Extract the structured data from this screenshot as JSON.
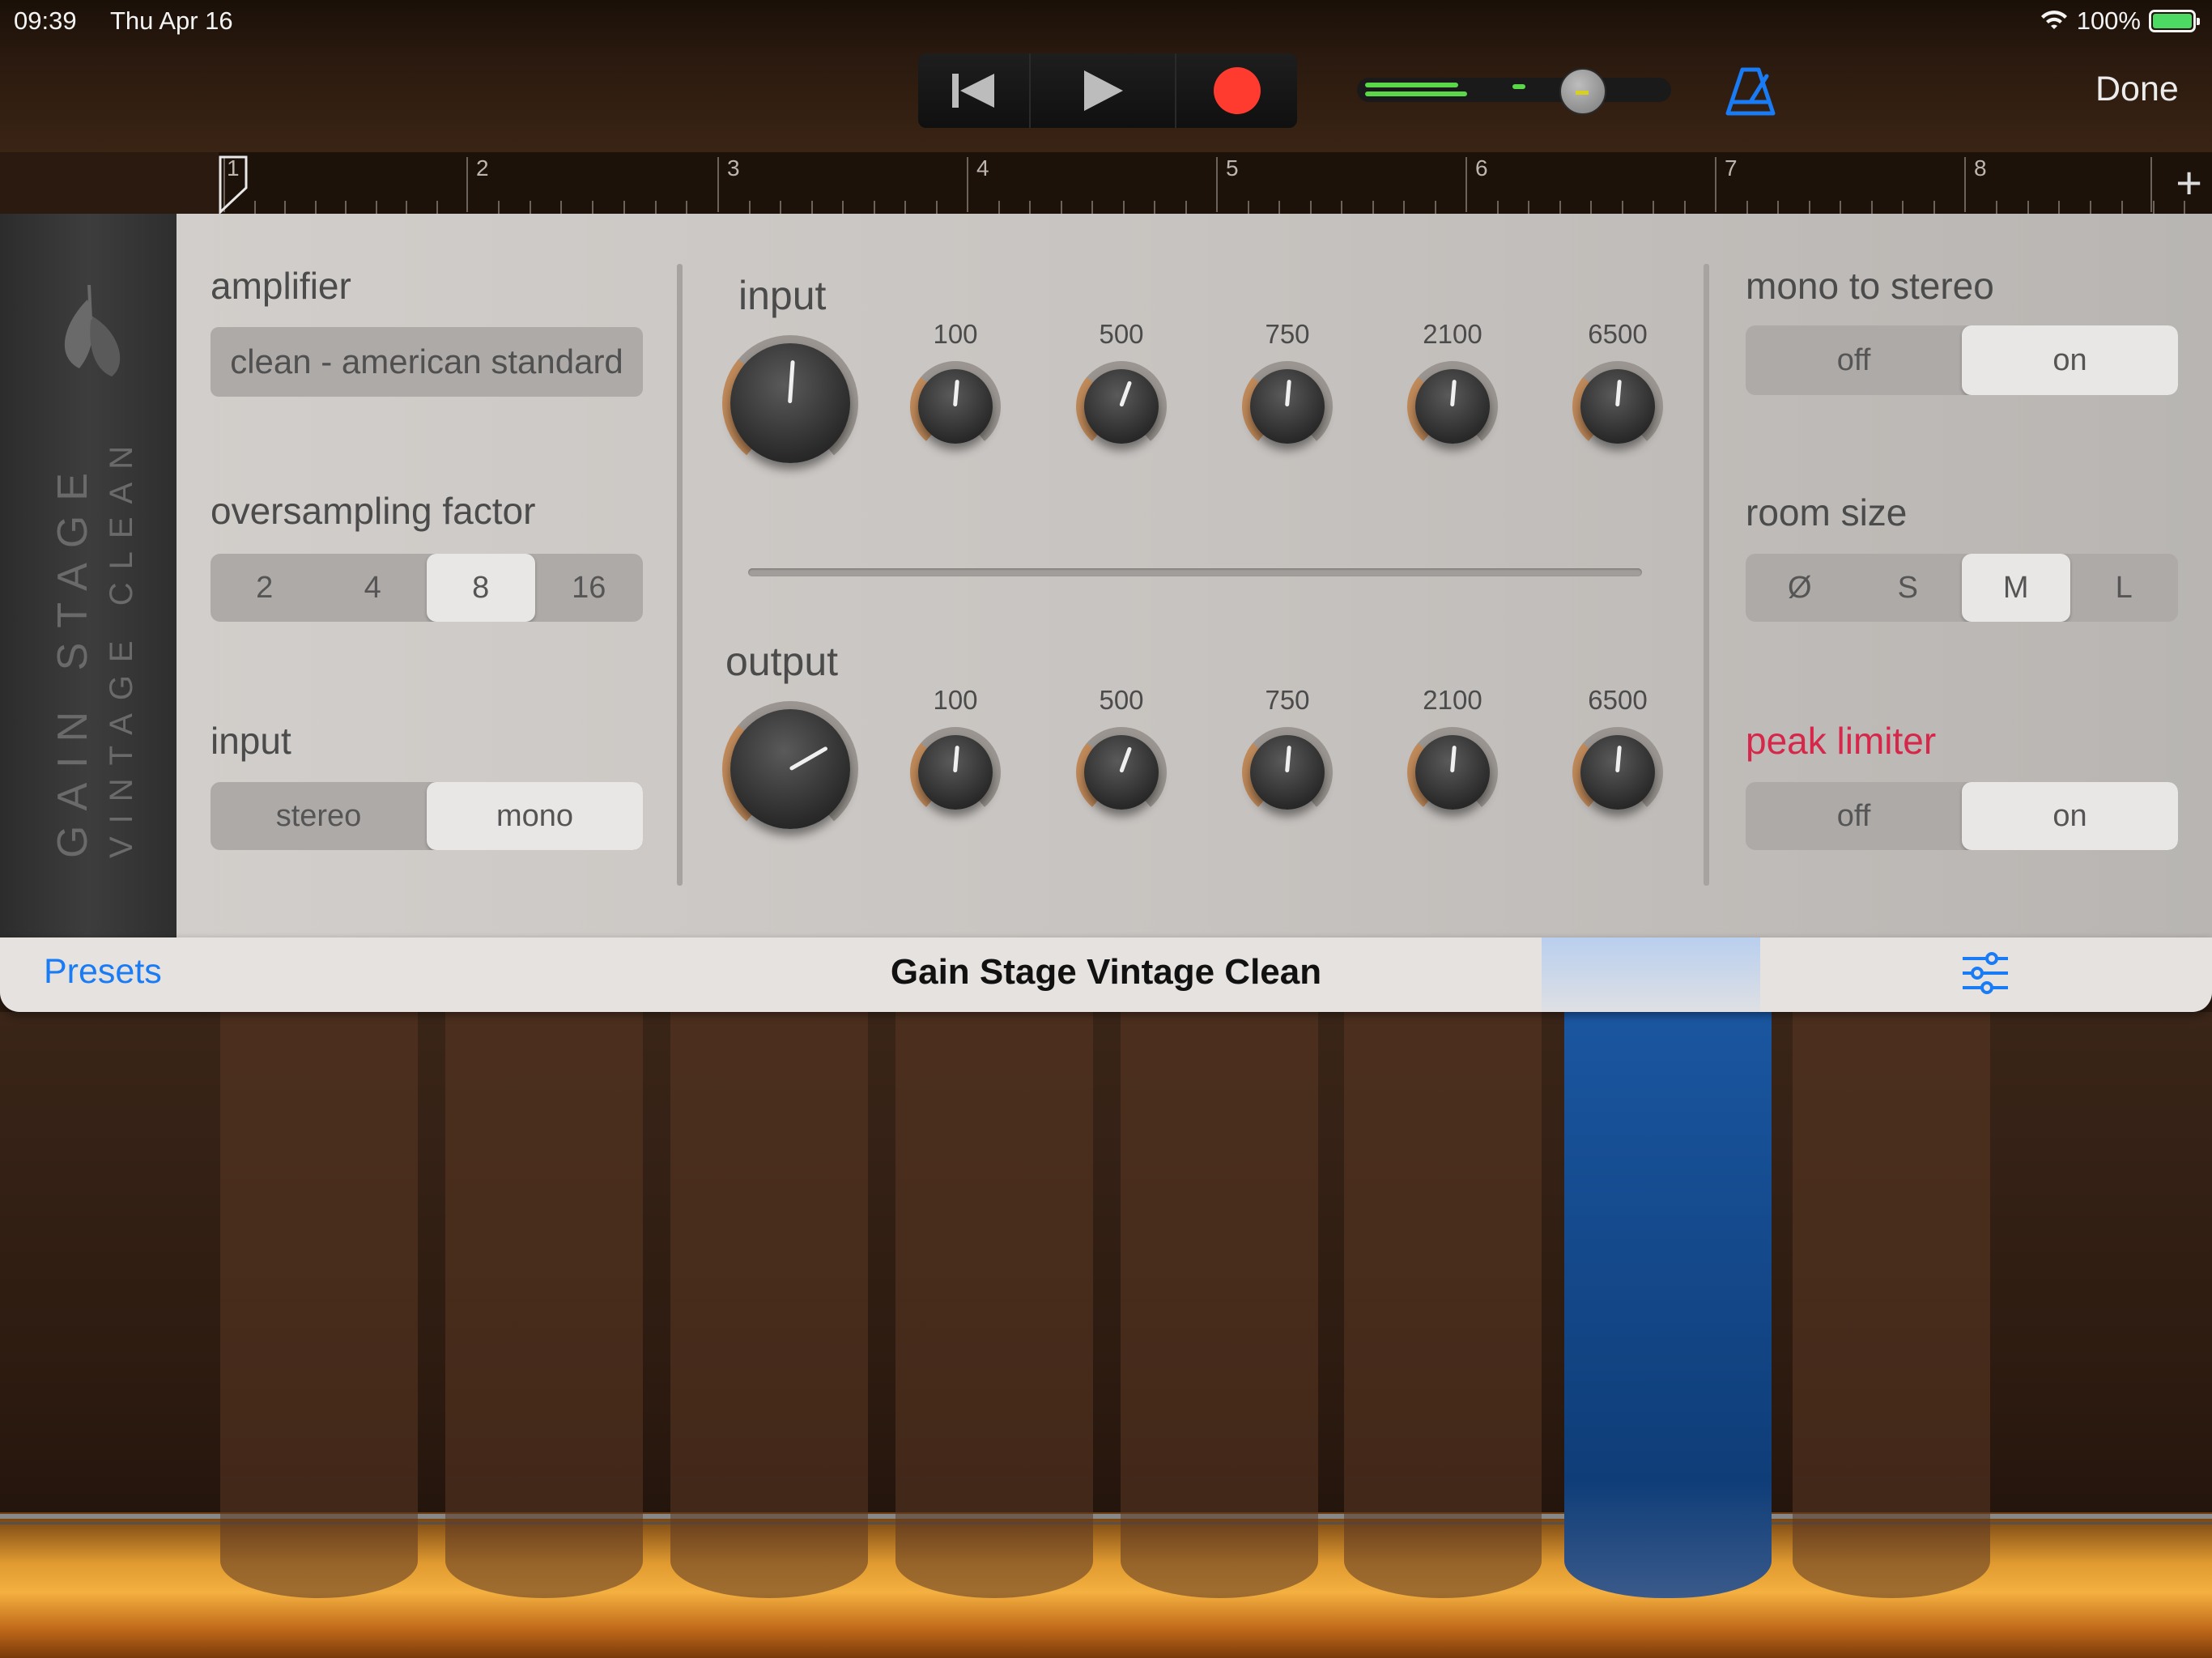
{
  "status_bar": {
    "time": "09:39",
    "date": "Thu Apr 16",
    "battery": "100%",
    "battery_level": 1.0
  },
  "toolbar": {
    "done_label": "Done",
    "rewind_icon": "rewind-icon",
    "play_icon": "play-icon",
    "record_icon": "record-icon",
    "metronome_icon": "metronome-icon",
    "record_color": "#ff3b30",
    "accent_color": "#1a7cf5"
  },
  "ruler": {
    "bars": [
      "1",
      "2",
      "3",
      "4",
      "5",
      "6",
      "7",
      "8"
    ],
    "add_label": "+"
  },
  "plugin": {
    "brand_title": "GAIN STAGE",
    "brand_subtitle": "VINTAGE CLEAN",
    "amplifier": {
      "label": "amplifier",
      "value": "clean - american standard"
    },
    "oversampling": {
      "label": "oversampling factor",
      "options": [
        "2",
        "4",
        "8",
        "16"
      ],
      "selected": "8"
    },
    "input_mode": {
      "label": "input",
      "options": [
        "stereo",
        "mono"
      ],
      "selected": "mono"
    },
    "eq": {
      "input": {
        "label": "input",
        "bands": [
          "100",
          "500",
          "750",
          "2100",
          "6500"
        ]
      },
      "output": {
        "label": "output",
        "bands": [
          "100",
          "500",
          "750",
          "2100",
          "6500"
        ]
      }
    },
    "mono_to_stereo": {
      "label": "mono to stereo",
      "options": [
        "off",
        "on"
      ],
      "selected": "on"
    },
    "room_size": {
      "label": "room size",
      "options": [
        "Ø",
        "S",
        "M",
        "L"
      ],
      "selected": "M"
    },
    "peak_limiter": {
      "label": "peak limiter",
      "options": [
        "off",
        "on"
      ],
      "selected": "on",
      "label_color": "#d6264a"
    }
  },
  "bottom_bar": {
    "presets_label": "Presets",
    "preset_name": "Gain Stage Vintage Clean"
  }
}
